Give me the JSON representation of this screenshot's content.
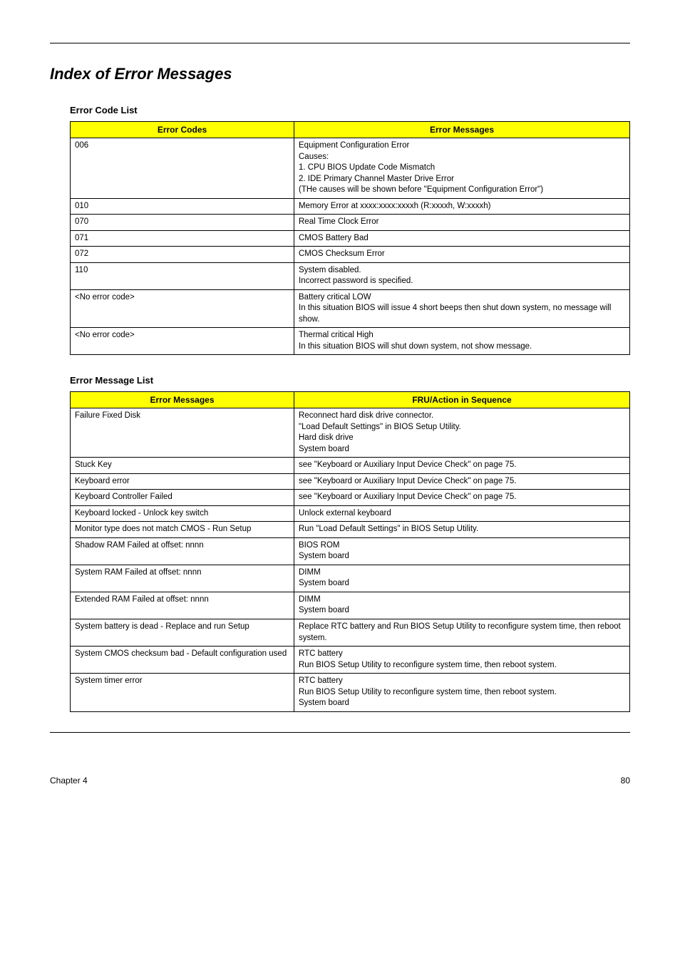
{
  "title": "Index of Error Messages",
  "sections": {
    "errorCodeList": {
      "heading": "Error Code List",
      "headers": [
        "Error Codes",
        "Error Messages"
      ],
      "rows": [
        {
          "code": "006",
          "msg": "Equipment Configuration Error\nCauses:\n1. CPU BIOS Update Code Mismatch\n2. IDE Primary Channel Master Drive Error\n(THe causes will be shown before \"Equipment Configuration Error\")"
        },
        {
          "code": "010",
          "msg": "Memory Error at xxxx:xxxx:xxxxh (R:xxxxh, W:xxxxh)"
        },
        {
          "code": "070",
          "msg": "Real Time Clock Error"
        },
        {
          "code": "071",
          "msg": "CMOS Battery Bad"
        },
        {
          "code": "072",
          "msg": "CMOS Checksum Error"
        },
        {
          "code": "110",
          "msg": "System disabled.\nIncorrect password is specified."
        },
        {
          "code": "<No error code>",
          "msg": "Battery critical LOW\nIn this situation BIOS will issue 4 short beeps then shut down system, no message will show."
        },
        {
          "code": "<No error code>",
          "msg": "Thermal critical High\nIn this situation BIOS will shut down system, not show message."
        }
      ]
    },
    "errorMessageList": {
      "heading": "Error Message List",
      "headers": [
        "Error Messages",
        "FRU/Action in Sequence"
      ],
      "rows": [
        {
          "code": "Failure Fixed Disk",
          "msg": "Reconnect hard disk drive connector.\n\"Load Default Settings\" in BIOS Setup Utility.\nHard disk drive\nSystem board"
        },
        {
          "code": "Stuck Key",
          "msg": "see \"Keyboard or Auxiliary Input Device Check\" on page 75."
        },
        {
          "code": "Keyboard error",
          "msg": "see \"Keyboard or Auxiliary Input Device Check\" on page 75."
        },
        {
          "code": "Keyboard Controller Failed",
          "msg": "see \"Keyboard or Auxiliary Input Device Check\" on page 75."
        },
        {
          "code": "Keyboard locked - Unlock key switch",
          "msg": "Unlock external keyboard"
        },
        {
          "code": "Monitor type does not match CMOS - Run Setup",
          "msg": "Run \"Load Default Settings\" in BIOS Setup Utility."
        },
        {
          "code": "Shadow RAM Failed at offset: nnnn",
          "msg": "BIOS ROM\nSystem board"
        },
        {
          "code": "System RAM Failed at offset: nnnn",
          "msg": "DIMM\nSystem board"
        },
        {
          "code": "Extended RAM Failed at offset: nnnn",
          "msg": "DIMM\nSystem board"
        },
        {
          "code": "System battery is dead - Replace and run Setup",
          "msg": "Replace RTC battery and Run BIOS Setup Utility to reconfigure system time, then reboot system."
        },
        {
          "code": "System CMOS checksum bad - Default configuration used",
          "msg": "RTC battery\nRun BIOS Setup Utility to reconfigure system time, then reboot system."
        },
        {
          "code": "System timer error",
          "msg": "RTC battery\nRun BIOS Setup Utility to reconfigure system time, then reboot system.\nSystem board"
        }
      ]
    }
  },
  "footer": {
    "left": "Chapter 4",
    "right": "80"
  }
}
